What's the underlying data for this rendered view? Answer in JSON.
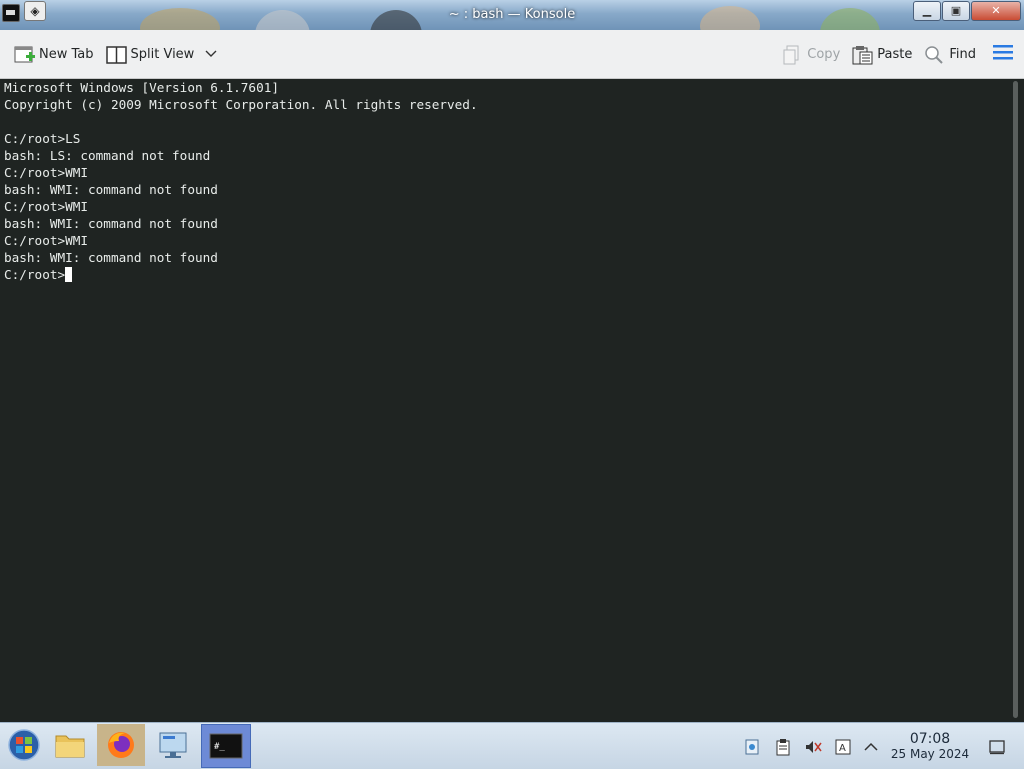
{
  "window": {
    "title": "~ : bash — Konsole",
    "controls": [
      "minimize",
      "maximize",
      "close"
    ]
  },
  "toolbar": {
    "new_tab": "New Tab",
    "split_view": "Split View",
    "copy": "Copy",
    "paste": "Paste",
    "find": "Find"
  },
  "terminal": {
    "lines": [
      "Microsoft Windows [Version 6.1.7601]",
      "Copyright (c) 2009 Microsoft Corporation. All rights reserved.",
      "",
      "C:/root>LS",
      "bash: LS: command not found",
      "C:/root>WMI",
      "bash: WMI: command not found",
      "C:/root>WMI",
      "bash: WMI: command not found",
      "C:/root>WMI",
      "bash: WMI: command not found"
    ],
    "prompt": "C:/root>"
  },
  "taskbar": {
    "apps": [
      "start-menu",
      "file-manager",
      "firefox",
      "system-settings",
      "konsole"
    ],
    "clock_time": "07:08",
    "clock_date": "25 May 2024"
  },
  "colors": {
    "terminal_bg": "#1f2422",
    "terminal_fg": "#e8ecea",
    "toolbar_bg": "#eff0f1"
  }
}
